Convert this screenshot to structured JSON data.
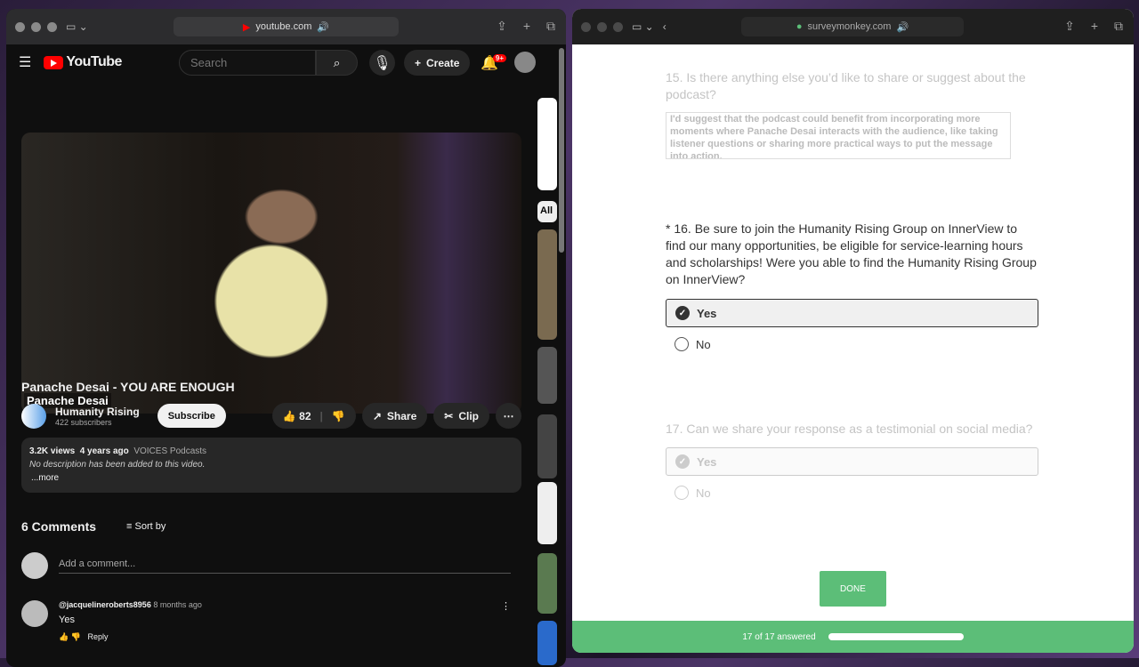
{
  "left_window": {
    "url": "youtube.com",
    "youtube": {
      "logo": "YouTube",
      "search_placeholder": "Search",
      "create_label": "Create",
      "notif_badge": "9+",
      "video_overlay": "Panache Desai",
      "video_title": "Panache Desai - YOU ARE ENOUGH",
      "channel": {
        "name": "Humanity Rising",
        "subs": "422 subscribers",
        "subscribe": "Subscribe"
      },
      "likes": "82",
      "share": "Share",
      "clip": "Clip",
      "more": "⋯",
      "desc": {
        "views": "3.2K views",
        "age": "4 years ago",
        "tag": "VOICES Podcasts",
        "text": "No description has been added to this video.",
        "more": "...more"
      },
      "comments": {
        "count": "6 Comments",
        "sort": "Sort by",
        "placeholder": "Add a comment...",
        "items": [
          {
            "author": "@jacquelineroberts8956",
            "time": "8 months ago",
            "text": "Yes",
            "reply": "Reply"
          }
        ]
      },
      "side_chip": "All"
    }
  },
  "right_window": {
    "url": "surveymonkey.com",
    "q15": {
      "text": "15. Is there anything else you’d like to share or suggest about the podcast?",
      "answer": "I'd suggest that the podcast could benefit from incorporating more moments where Panache Desai interacts with the audience, like taking listener questions or sharing more practical ways to put the message into action."
    },
    "q16": {
      "text": "* 16. Be sure to join the Humanity Rising Group on InnerView to find our many opportunities, be eligible for service-learning hours and scholarships! Were you able to find the Humanity Rising Group on InnerView?",
      "options": [
        "Yes",
        "No"
      ],
      "selected": "Yes"
    },
    "q17": {
      "text": "17. Can we share your response as a testimonial on social media?",
      "options": [
        "Yes",
        "No"
      ],
      "selected": "Yes"
    },
    "done": "DONE",
    "progress_text": "17 of 17 answered",
    "progress": 1.0,
    "accent": "#5cbe78"
  }
}
